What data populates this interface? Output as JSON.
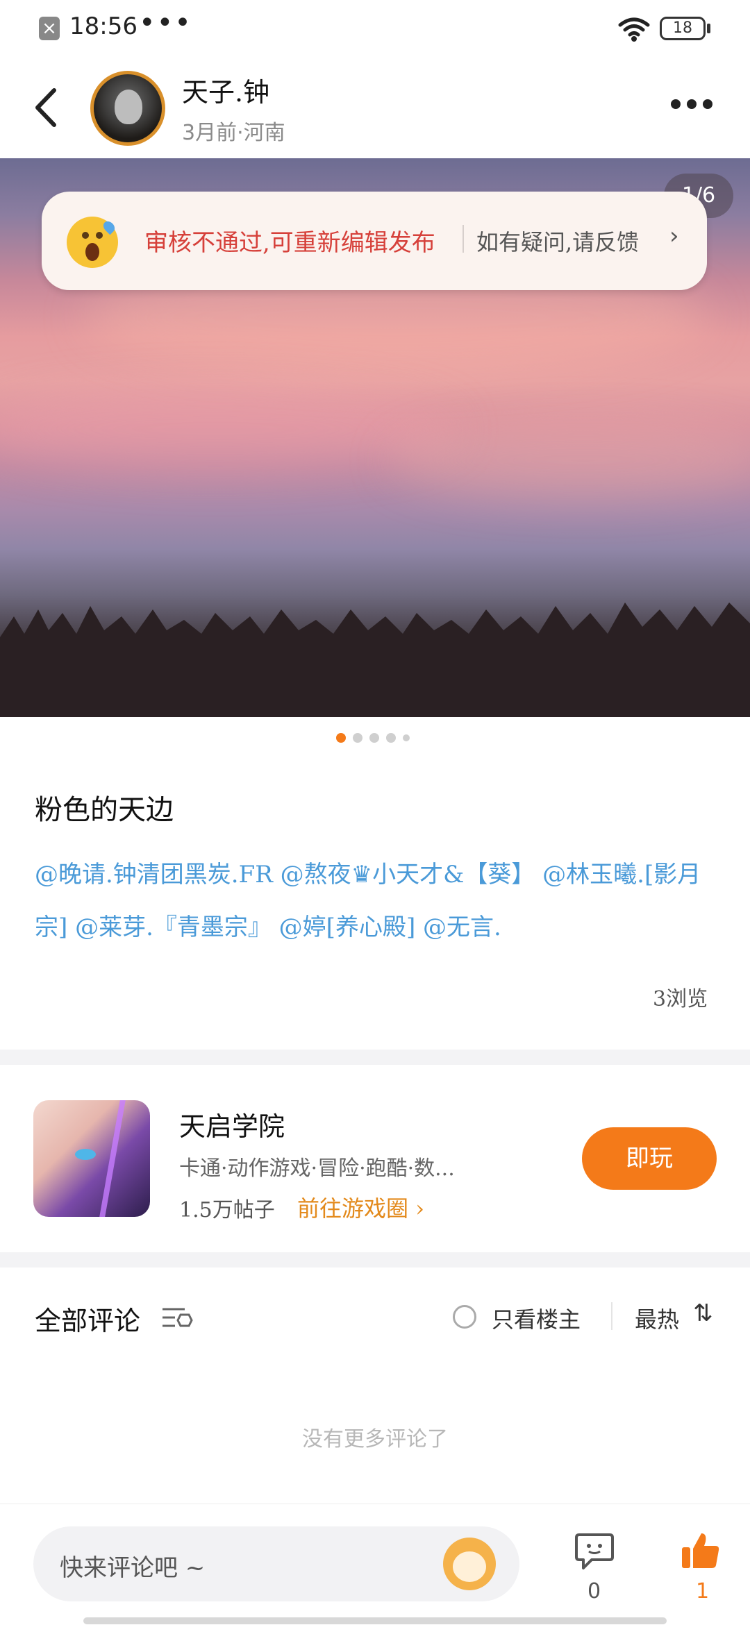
{
  "status_bar": {
    "time": "18:56",
    "dots": "•••",
    "battery": "18"
  },
  "header": {
    "username": "天子.钟",
    "meta": "3月前·河南"
  },
  "hero": {
    "image_counter": "1/6",
    "review_message": "审核不通过,可重新编辑发布",
    "review_feedback": "如有疑问,请反馈"
  },
  "pager": {
    "active_index": 0,
    "count": 5
  },
  "post": {
    "title": "粉色的天边",
    "mentions": "@晚请.钟清团黑炭.FR @熬夜♛小天才&【葵】 @林玉曦.[影月宗] @莱芽.『青墨宗』 @婷[养心殿] @无言.",
    "views": "3浏览"
  },
  "game": {
    "name": "天启学院",
    "tags": "卡通·动作游戏·冒险·跑酷·数...",
    "posts": "1.5万帖子",
    "link": "前往游戏圈",
    "play_label": "即玩"
  },
  "comments": {
    "title": "全部评论",
    "owner_only": "只看楼主",
    "sort": "最热",
    "empty_text": "没有更多评论了"
  },
  "bottom_bar": {
    "placeholder": "快来评论吧 ~",
    "comment_count": "0",
    "like_count": "1"
  },
  "colors": {
    "accent": "#f47a19",
    "mention": "#4a9ad8",
    "review_error": "#d6403a"
  }
}
